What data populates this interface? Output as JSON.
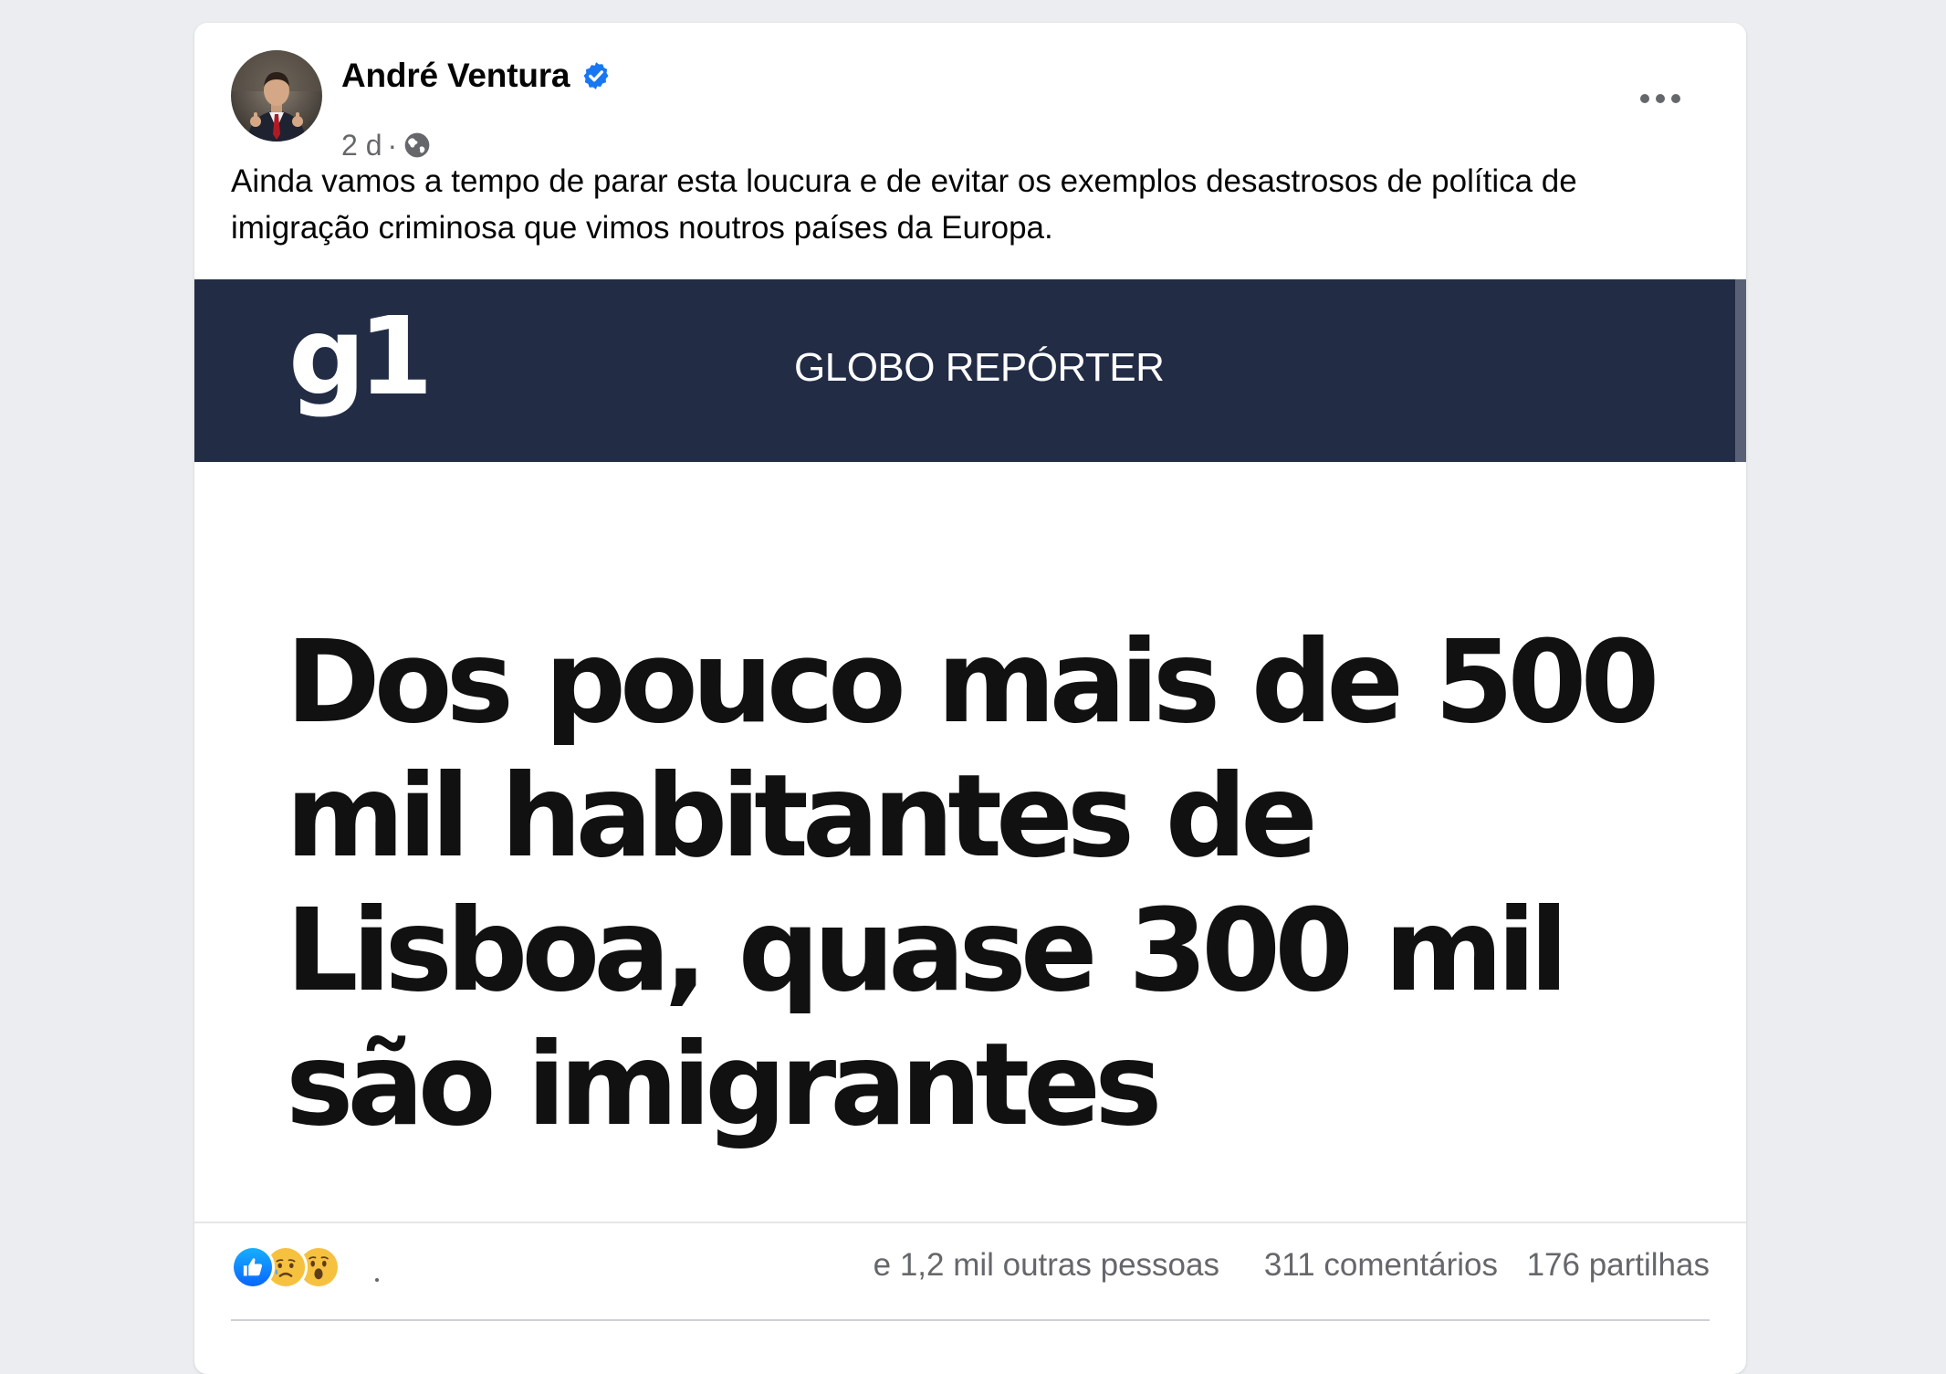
{
  "post": {
    "author": "André Ventura",
    "verified": true,
    "time": "2 d",
    "separator": "·",
    "audience_icon": "globe-icon",
    "menu_icon": "more-horizontal-icon",
    "caption": "Ainda vamos a tempo de parar esta loucura e de evitar os exemplos desastrosos de política de imigração criminosa que vimos noutros países da Europa."
  },
  "media": {
    "logo": "g1",
    "section": "GLOBO REPÓRTER",
    "headline": "Dos pouco mais de 500 mil habitantes de Lisboa, quase 300 mil são imigrantes",
    "banner_color": "#222c45"
  },
  "stats": {
    "reactions": [
      "like-icon",
      "sad-icon",
      "wow-icon"
    ],
    "reactions_text": "e 1,2 mil outras pessoas",
    "comments": "311 comentários",
    "shares": "176 partilhas"
  },
  "colors": {
    "facebook_blue": "#1877f2",
    "secondary_text": "#65676b",
    "background": "#ebedf0"
  }
}
